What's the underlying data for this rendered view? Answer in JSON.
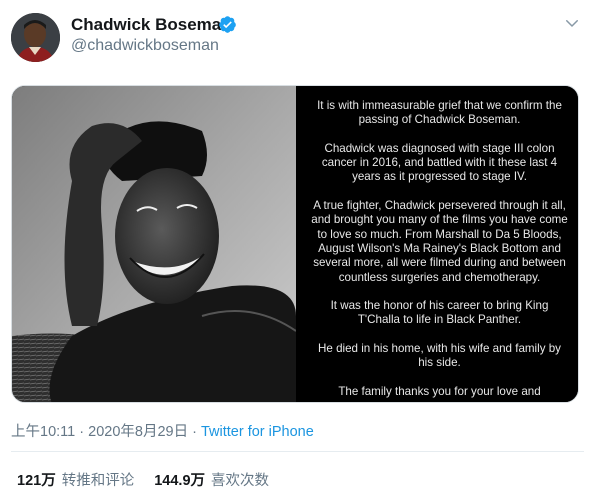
{
  "author": {
    "name": "Chadwick Boseman",
    "handle": "@chadwickboseman",
    "verified_icon": "verified-badge-icon",
    "brand_color": "#1da1f2"
  },
  "media": {
    "statement_paragraphs": [
      "It is with immeasurable grief that we confirm the passing of Chadwick Boseman.",
      "Chadwick was diagnosed with stage III colon cancer in 2016, and battled with it these last 4 years as it progressed to stage IV.",
      "A true fighter, Chadwick persevered through it all, and brought you many of the films you have come to love so much. From Marshall to Da 5 Bloods, August Wilson's Ma Rainey's Black Bottom and several more, all were filmed during and between countless surgeries and chemotherapy.",
      "It was the honor of his career to bring King T'Challa to life in Black Panther.",
      "He died in his home, with his wife and family by his side.",
      "The family thanks you for your love and"
    ]
  },
  "meta": {
    "time": "上午10:11",
    "separator": "·",
    "date": "2020年8月29日",
    "source": "Twitter for iPhone",
    "link_color": "#1b95e0"
  },
  "stats": {
    "retweets_count": "121万",
    "retweets_label": "转推和评论",
    "likes_count": "144.9万",
    "likes_label": "喜欢次数"
  }
}
